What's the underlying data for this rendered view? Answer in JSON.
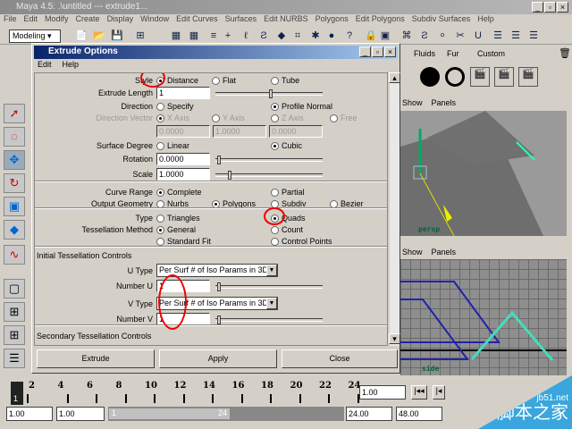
{
  "app": {
    "title": "Maya 4.5: .\\untitled   ---   extrude1...",
    "menus": [
      "File",
      "Edit",
      "Modify",
      "Create",
      "Display",
      "Window",
      "Edit Curves",
      "Surfaces",
      "Edit NURBS",
      "Polygons",
      "Edit Polygons",
      "Subdiv Surfaces",
      "Help"
    ],
    "mode": "Modeling",
    "shelf_tabs": [
      "Fluids",
      "Fur",
      "Custom"
    ]
  },
  "dialog": {
    "title": "Extrude Options",
    "menus": [
      "Edit",
      "Help"
    ],
    "style": {
      "label": "Style",
      "options": [
        "Distance",
        "Flat",
        "Tube"
      ],
      "selected": "Distance"
    },
    "extrude_length": {
      "label": "Extrude Length",
      "value": "1"
    },
    "direction": {
      "label": "Direction",
      "options": [
        "Specify",
        "Profile Normal"
      ],
      "selected": "Profile Normal"
    },
    "direction_vector": {
      "label": "Direction Vector",
      "options": [
        "X Axis",
        "Y Axis",
        "Z Axis",
        "Free"
      ],
      "values": [
        "0.0000",
        "1.0000",
        "0.0000"
      ]
    },
    "surface_degree": {
      "label": "Surface Degree",
      "options": [
        "Linear",
        "Cubic"
      ],
      "selected": "Cubic"
    },
    "rotation": {
      "label": "Rotation",
      "value": "0.0000"
    },
    "scale": {
      "label": "Scale",
      "value": "1.0000"
    },
    "curve_range": {
      "label": "Curve Range",
      "options": [
        "Complete",
        "Partial"
      ],
      "selected": "Complete"
    },
    "output_geometry": {
      "label": "Output Geometry",
      "options": [
        "Nurbs",
        "Polygons",
        "Subdiv",
        "Bezier"
      ],
      "selected": "Polygons"
    },
    "type": {
      "label": "Type",
      "options": [
        "Triangles",
        "Quads"
      ],
      "selected": "Quads"
    },
    "tess_method": {
      "label": "Tessellation Method",
      "options": [
        "General",
        "Count",
        "Standard Fit",
        "Control Points"
      ],
      "selected": "General"
    },
    "initial_tess": {
      "heading": "Initial Tessellation Controls",
      "u_type_label": "U Type",
      "u_type": "Per Surf # of Iso Params in 3D",
      "number_u_label": "Number U",
      "number_u": "1",
      "v_type_label": "V Type",
      "v_type": "Per Surf # of Iso Params in 3D",
      "number_v_label": "Number V",
      "number_v": "1"
    },
    "secondary_tess": {
      "heading": "Secondary Tessellation Controls"
    },
    "buttons": {
      "extrude": "Extrude",
      "apply": "Apply",
      "close": "Close"
    }
  },
  "viewports": {
    "top": {
      "menus": [
        "Show",
        "Panels"
      ],
      "camera": "persp"
    },
    "bottom": {
      "menus": [
        "Show",
        "Panels"
      ],
      "camera": "side"
    }
  },
  "timeline": {
    "ticks": [
      "2",
      "4",
      "6",
      "8",
      "10",
      "12",
      "14",
      "16",
      "18",
      "20",
      "22",
      "24"
    ],
    "current_frame": "1",
    "current_time": "1.00",
    "start": "1.00",
    "range_start": "1.00",
    "range_min_label": "1",
    "range_max_label": "24",
    "range_end": "24.00",
    "end": "48.00"
  },
  "watermark": {
    "site": "jb51.net",
    "text": "脚本之家"
  }
}
